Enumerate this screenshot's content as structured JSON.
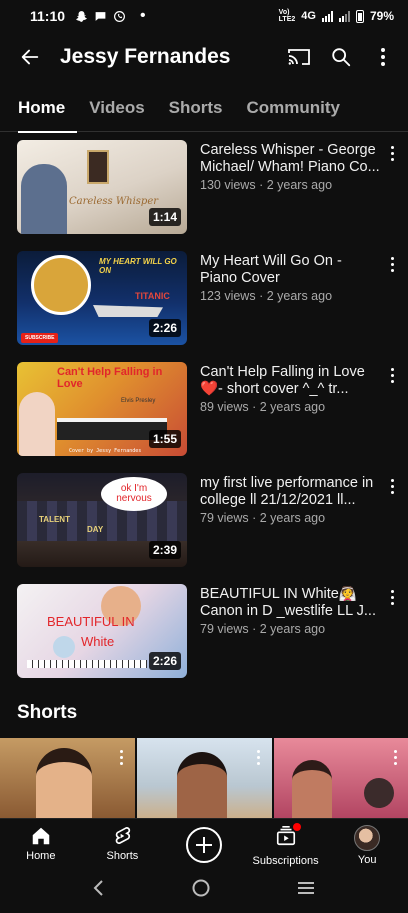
{
  "status_bar": {
    "time": "11:10",
    "network_top": "Vo)",
    "network_bottom": "LTE2",
    "network_type": "4G",
    "battery": "79%"
  },
  "header": {
    "title": "Jessy Fernandes",
    "back_icon": "back-arrow-icon",
    "cast_icon": "cast-icon",
    "search_icon": "search-icon",
    "menu_icon": "more-vert-icon"
  },
  "tabs": [
    {
      "label": "Home",
      "active": true
    },
    {
      "label": "Videos",
      "active": false
    },
    {
      "label": "Shorts",
      "active": false
    },
    {
      "label": "Community",
      "active": false
    }
  ],
  "videos": [
    {
      "title": "Careless Whisper - George Michael/ Wham! Piano Co...",
      "views": "130 views",
      "age": "2 years ago",
      "duration": "1:14",
      "thumb_text": "Careless Whisper"
    },
    {
      "title": "My Heart Will Go On - Piano Cover",
      "views": "123 views",
      "age": "2 years ago",
      "duration": "2:26",
      "thumb_text": "MY HEART WILL GO ON",
      "thumb_text2": "TITANIC",
      "thumb_badge": "SUBSCRIBE"
    },
    {
      "title": "Can't Help Falling in Love❤️- short cover ^_^ tr...",
      "views": "89 views",
      "age": "2 years ago",
      "duration": "1:55",
      "thumb_text": "Can't Help Falling in Love",
      "thumb_text2": "Elvis Presley",
      "thumb_text3": "Cover by Jessy Fernandes"
    },
    {
      "title": "my first live performance in college ll 21/12/2021 ll...",
      "views": "79 views",
      "age": "2 years ago",
      "duration": "2:39",
      "thumb_text": "ok I'm nervous",
      "thumb_text2": "TALENT",
      "thumb_text3": "DAY"
    },
    {
      "title": "BEAUTIFUL IN White👰 Canon in D _westlife LL J...",
      "views": "79 views",
      "age": "2 years ago",
      "duration": "2:26",
      "thumb_text": "BEAUTIFUL IN",
      "thumb_text2": "White"
    }
  ],
  "shorts_section": {
    "title": "Shorts"
  },
  "bottom_nav": [
    {
      "label": "Home",
      "icon": "home-icon"
    },
    {
      "label": "Shorts",
      "icon": "shorts-icon"
    },
    {
      "label": "",
      "icon": "create-icon"
    },
    {
      "label": "Subscriptions",
      "icon": "subscriptions-icon"
    },
    {
      "label": "You",
      "icon": "avatar"
    }
  ],
  "colors": {
    "background": "#0f0f0f",
    "text_primary": "#f1f1f1",
    "text_secondary": "#aaaaaa",
    "notification_dot": "#ff0000"
  }
}
